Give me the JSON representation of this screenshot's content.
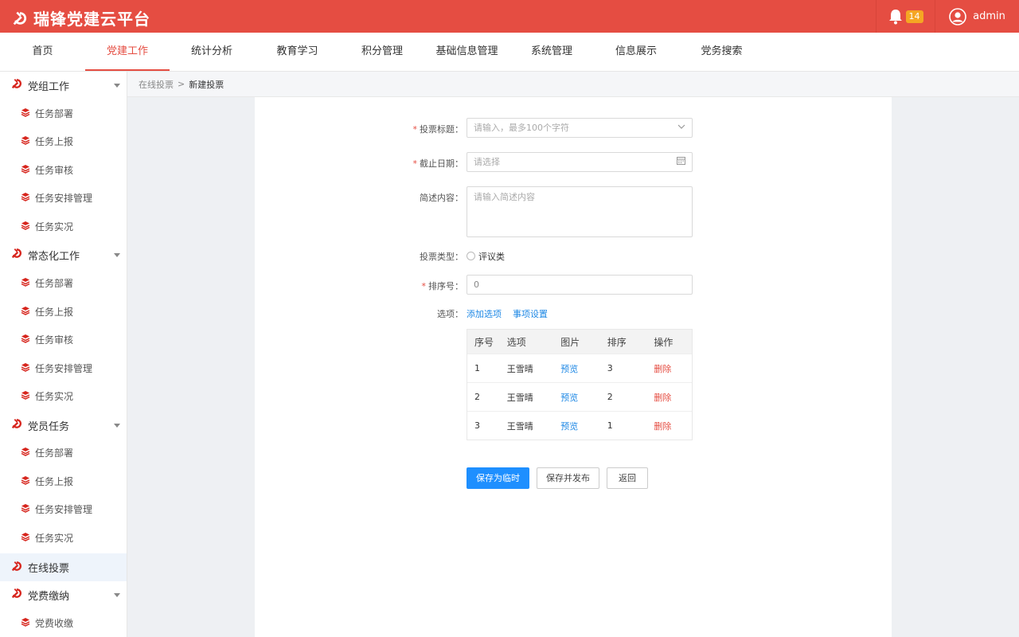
{
  "app": {
    "title": "瑞锋党建云平台"
  },
  "header": {
    "notification_count": "14",
    "username": "admin"
  },
  "nav": {
    "items": [
      "首页",
      "党建工作",
      "统计分析",
      "教育学习",
      "积分管理",
      "基础信息管理",
      "系统管理",
      "信息展示",
      "党务搜索"
    ],
    "active": "党建工作"
  },
  "sidebar": {
    "groups": [
      {
        "label": "党组工作",
        "items": [
          "任务部署",
          "任务上报",
          "任务审核",
          "任务安排管理",
          "任务实况"
        ]
      },
      {
        "label": "常态化工作",
        "items": [
          "任务部署",
          "任务上报",
          "任务审核",
          "任务安排管理",
          "任务实况"
        ]
      },
      {
        "label": "党员任务",
        "items": [
          "任务部署",
          "任务上报",
          "任务安排管理",
          "任务实况"
        ]
      },
      {
        "label": "在线投票",
        "items": []
      },
      {
        "label": "党费缴纳",
        "items": [
          "党费收缴"
        ]
      }
    ],
    "active": "在线投票"
  },
  "breadcrumb": {
    "parent": "在线投票",
    "separator": ">",
    "current": "新建投票"
  },
  "form": {
    "title_label": "投票标题：",
    "title_placeholder": "请输入，最多100个字符",
    "deadline_label": "截止日期：",
    "deadline_placeholder": "请选择",
    "desc_label": "简述内容：",
    "desc_placeholder": "请输入简述内容",
    "type_label": "投票类型：",
    "type_option": "评议类",
    "order_label": "排序号：",
    "order_value": "0",
    "options_label": "选项：",
    "add_option": "添加选项",
    "option_settings": "事项设置"
  },
  "table": {
    "headers": [
      "序号",
      "选项",
      "图片",
      "排序",
      "操作"
    ],
    "rows": [
      {
        "no": "1",
        "option": "王雪晴",
        "image": "预览",
        "order": "3",
        "action": "删除"
      },
      {
        "no": "2",
        "option": "王雪晴",
        "image": "预览",
        "order": "2",
        "action": "删除"
      },
      {
        "no": "3",
        "option": "王雪晴",
        "image": "预览",
        "order": "1",
        "action": "删除"
      }
    ]
  },
  "buttons": {
    "save_draft": "保存为临时",
    "save_publish": "保存并发布",
    "back": "返回"
  },
  "colors": {
    "brand": "#e54d42",
    "primary": "#1e8fff",
    "link": "#1e88e5",
    "badge": "#f5a623"
  }
}
